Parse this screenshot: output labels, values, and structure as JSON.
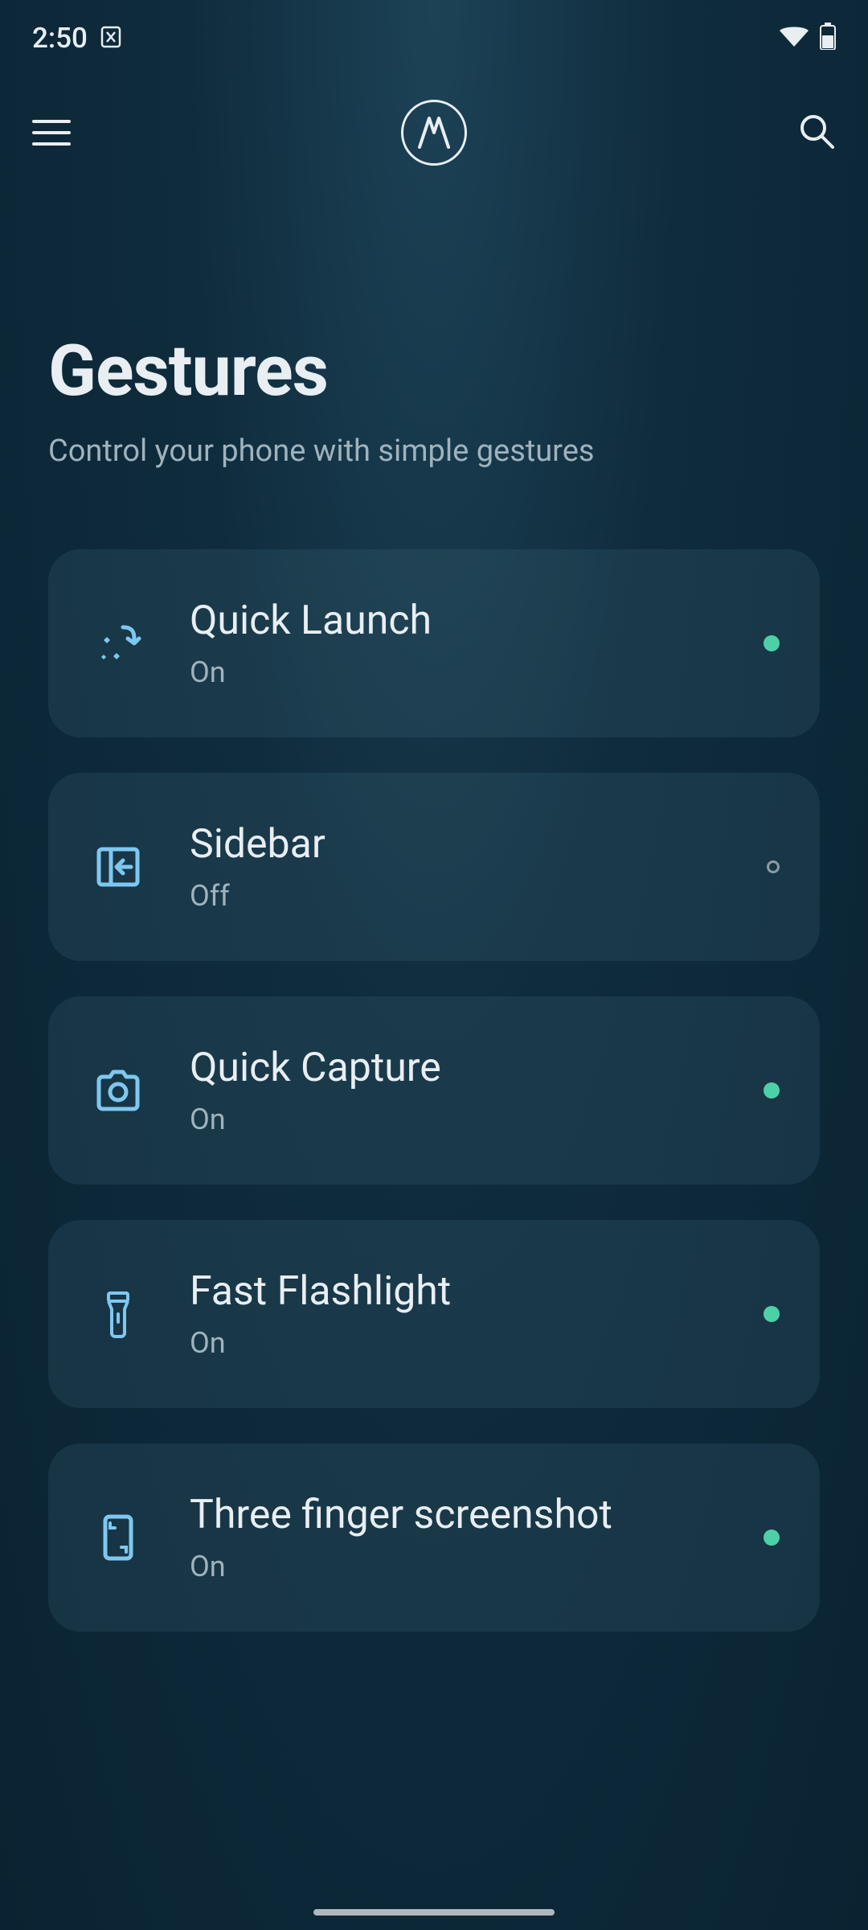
{
  "status_bar": {
    "time": "2:50"
  },
  "header": {
    "title": "Gestures",
    "subtitle": "Control your phone with simple gestures"
  },
  "items": [
    {
      "title": "Quick Launch",
      "status": "On",
      "enabled": true,
      "icon": "sparkle-arrow"
    },
    {
      "title": "Sidebar",
      "status": "Off",
      "enabled": false,
      "icon": "sidebar-arrow"
    },
    {
      "title": "Quick Capture",
      "status": "On",
      "enabled": true,
      "icon": "camera"
    },
    {
      "title": "Fast Flashlight",
      "status": "On",
      "enabled": true,
      "icon": "flashlight"
    },
    {
      "title": "Three finger screenshot",
      "status": "On",
      "enabled": true,
      "icon": "phone-screenshot"
    }
  ]
}
